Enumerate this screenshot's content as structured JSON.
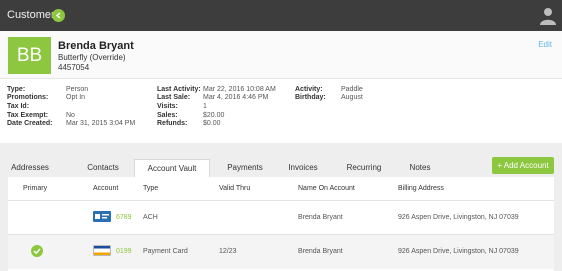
{
  "topbar": {
    "title": "Customers"
  },
  "header": {
    "initials": "BB",
    "name": "Brenda Bryant",
    "plan": "Butterfly (Override)",
    "customer_id": "4457054",
    "edit_label": "Edit"
  },
  "info": {
    "col1": [
      {
        "label": "Type:",
        "value": "Person"
      },
      {
        "label": "Promotions:",
        "value": "Opt In"
      },
      {
        "label": "Tax Id:",
        "value": ""
      },
      {
        "label": "Tax Exempt:",
        "value": "No"
      },
      {
        "label": "Date Created:",
        "value": "Mar 31, 2015 3:04 PM"
      }
    ],
    "col2": [
      {
        "label": "Last Activity:",
        "value": "Mar 22, 2016 10:08 AM"
      },
      {
        "label": "Last Sale:",
        "value": "Mar 4, 2016 4:46 PM"
      },
      {
        "label": "Visits:",
        "value": "1"
      },
      {
        "label": "Sales:",
        "value": "$20.00"
      },
      {
        "label": "Refunds:",
        "value": "$0.00"
      }
    ],
    "col3": [
      {
        "label": "Activity:",
        "value": "Paddle"
      },
      {
        "label": "Birthday:",
        "value": "August"
      }
    ]
  },
  "tabs": [
    {
      "label": "Addresses"
    },
    {
      "label": "Contacts"
    },
    {
      "label": "Account Vault"
    },
    {
      "label": "Payments"
    },
    {
      "label": "Invoices"
    },
    {
      "label": "Recurring"
    },
    {
      "label": "Notes"
    }
  ],
  "add_account_label": "+ Add Account",
  "table": {
    "headers": [
      "Primary",
      "Account",
      "Type",
      "Valid Thru",
      "Name On Account",
      "Billing Address"
    ],
    "rows": [
      {
        "primary": false,
        "card": "ach",
        "account": "6789",
        "type": "ACH",
        "valid_thru": "",
        "name": "Brenda Bryant",
        "address": "926 Aspen Drive, Livingston, NJ 07039"
      },
      {
        "primary": true,
        "card": "visa",
        "account": "0199",
        "type": "Payment Card",
        "valid_thru": "12/23",
        "name": "Brenda Bryant",
        "address": "926 Aspen Drive, Livingston, NJ 07039"
      }
    ]
  },
  "colors": {
    "accent": "#8dc63f",
    "topbar": "#3d3d3d",
    "link": "#63b4e4"
  }
}
